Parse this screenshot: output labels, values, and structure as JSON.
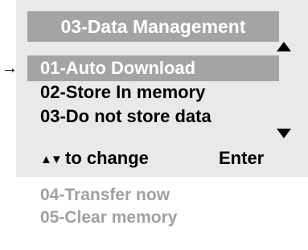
{
  "screen": {
    "title": "03-Data Management",
    "cursor": "→",
    "visible_items": [
      {
        "label": "01-Auto Download",
        "selected": true
      },
      {
        "label": "02-Store In memory",
        "selected": false
      },
      {
        "label": "03-Do not store data",
        "selected": false
      }
    ],
    "scroll_icons": [
      "triangle-up-icon",
      "triangle-down-icon"
    ]
  },
  "footer": {
    "arrows": "▲▼",
    "change_label": "to change",
    "enter_label": "Enter"
  },
  "hidden_items": [
    {
      "label": "04-Transfer now"
    },
    {
      "label": "05-Clear memory"
    }
  ],
  "colors": {
    "lcd_background": "#e9e9e9",
    "highlight": "#a4a4a4",
    "highlight_text": "#ffffff",
    "text": "#000000",
    "offscreen_text": "#a0a0a0"
  }
}
